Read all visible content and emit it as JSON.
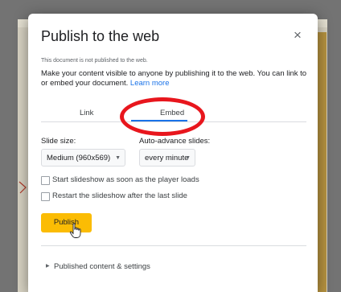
{
  "dialog": {
    "title": "Publish to the web",
    "close_glyph": "×",
    "status": "This document is not published to the web.",
    "description": "Make your content visible to anyone by publishing it to the web. You can link to or embed your document. ",
    "learn_more": "Learn more"
  },
  "tabs": [
    {
      "label": "Link",
      "selected": false
    },
    {
      "label": "Embed",
      "selected": true
    }
  ],
  "slide_size": {
    "label": "Slide size:",
    "value": "Medium (960x569)"
  },
  "auto_advance": {
    "label": "Auto-advance slides:",
    "value": "every minute"
  },
  "options": [
    {
      "label": "Start slideshow as soon as the player loads",
      "checked": false
    },
    {
      "label": "Restart the slideshow after the last slide",
      "checked": false
    }
  ],
  "publish_label": "Publish",
  "settings_label": "Published content & settings",
  "colors": {
    "accent": "#1a73e8",
    "publish_button": "#fbbc04",
    "annotation": "#e8161d"
  },
  "icons": {
    "close": "close-icon",
    "dropdown": "chevron-down-icon",
    "expand": "expand-triangle-icon",
    "cursor": "hand-pointer-icon"
  }
}
